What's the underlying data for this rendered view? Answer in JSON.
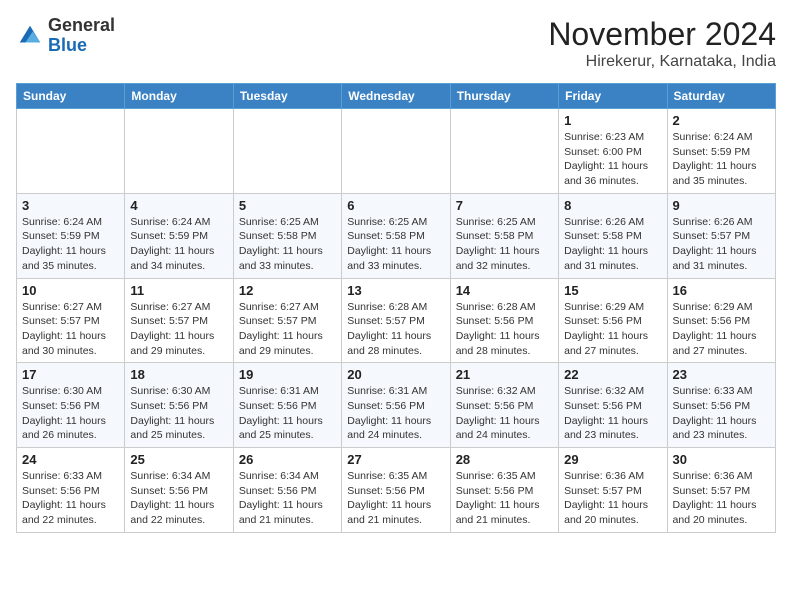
{
  "header": {
    "logo_general": "General",
    "logo_blue": "Blue",
    "month": "November 2024",
    "location": "Hirekerur, Karnataka, India"
  },
  "weekdays": [
    "Sunday",
    "Monday",
    "Tuesday",
    "Wednesday",
    "Thursday",
    "Friday",
    "Saturday"
  ],
  "weeks": [
    [
      {
        "day": "",
        "info": ""
      },
      {
        "day": "",
        "info": ""
      },
      {
        "day": "",
        "info": ""
      },
      {
        "day": "",
        "info": ""
      },
      {
        "day": "",
        "info": ""
      },
      {
        "day": "1",
        "info": "Sunrise: 6:23 AM\nSunset: 6:00 PM\nDaylight: 11 hours\nand 36 minutes."
      },
      {
        "day": "2",
        "info": "Sunrise: 6:24 AM\nSunset: 5:59 PM\nDaylight: 11 hours\nand 35 minutes."
      }
    ],
    [
      {
        "day": "3",
        "info": "Sunrise: 6:24 AM\nSunset: 5:59 PM\nDaylight: 11 hours\nand 35 minutes."
      },
      {
        "day": "4",
        "info": "Sunrise: 6:24 AM\nSunset: 5:59 PM\nDaylight: 11 hours\nand 34 minutes."
      },
      {
        "day": "5",
        "info": "Sunrise: 6:25 AM\nSunset: 5:58 PM\nDaylight: 11 hours\nand 33 minutes."
      },
      {
        "day": "6",
        "info": "Sunrise: 6:25 AM\nSunset: 5:58 PM\nDaylight: 11 hours\nand 33 minutes."
      },
      {
        "day": "7",
        "info": "Sunrise: 6:25 AM\nSunset: 5:58 PM\nDaylight: 11 hours\nand 32 minutes."
      },
      {
        "day": "8",
        "info": "Sunrise: 6:26 AM\nSunset: 5:58 PM\nDaylight: 11 hours\nand 31 minutes."
      },
      {
        "day": "9",
        "info": "Sunrise: 6:26 AM\nSunset: 5:57 PM\nDaylight: 11 hours\nand 31 minutes."
      }
    ],
    [
      {
        "day": "10",
        "info": "Sunrise: 6:27 AM\nSunset: 5:57 PM\nDaylight: 11 hours\nand 30 minutes."
      },
      {
        "day": "11",
        "info": "Sunrise: 6:27 AM\nSunset: 5:57 PM\nDaylight: 11 hours\nand 29 minutes."
      },
      {
        "day": "12",
        "info": "Sunrise: 6:27 AM\nSunset: 5:57 PM\nDaylight: 11 hours\nand 29 minutes."
      },
      {
        "day": "13",
        "info": "Sunrise: 6:28 AM\nSunset: 5:57 PM\nDaylight: 11 hours\nand 28 minutes."
      },
      {
        "day": "14",
        "info": "Sunrise: 6:28 AM\nSunset: 5:56 PM\nDaylight: 11 hours\nand 28 minutes."
      },
      {
        "day": "15",
        "info": "Sunrise: 6:29 AM\nSunset: 5:56 PM\nDaylight: 11 hours\nand 27 minutes."
      },
      {
        "day": "16",
        "info": "Sunrise: 6:29 AM\nSunset: 5:56 PM\nDaylight: 11 hours\nand 27 minutes."
      }
    ],
    [
      {
        "day": "17",
        "info": "Sunrise: 6:30 AM\nSunset: 5:56 PM\nDaylight: 11 hours\nand 26 minutes."
      },
      {
        "day": "18",
        "info": "Sunrise: 6:30 AM\nSunset: 5:56 PM\nDaylight: 11 hours\nand 25 minutes."
      },
      {
        "day": "19",
        "info": "Sunrise: 6:31 AM\nSunset: 5:56 PM\nDaylight: 11 hours\nand 25 minutes."
      },
      {
        "day": "20",
        "info": "Sunrise: 6:31 AM\nSunset: 5:56 PM\nDaylight: 11 hours\nand 24 minutes."
      },
      {
        "day": "21",
        "info": "Sunrise: 6:32 AM\nSunset: 5:56 PM\nDaylight: 11 hours\nand 24 minutes."
      },
      {
        "day": "22",
        "info": "Sunrise: 6:32 AM\nSunset: 5:56 PM\nDaylight: 11 hours\nand 23 minutes."
      },
      {
        "day": "23",
        "info": "Sunrise: 6:33 AM\nSunset: 5:56 PM\nDaylight: 11 hours\nand 23 minutes."
      }
    ],
    [
      {
        "day": "24",
        "info": "Sunrise: 6:33 AM\nSunset: 5:56 PM\nDaylight: 11 hours\nand 22 minutes."
      },
      {
        "day": "25",
        "info": "Sunrise: 6:34 AM\nSunset: 5:56 PM\nDaylight: 11 hours\nand 22 minutes."
      },
      {
        "day": "26",
        "info": "Sunrise: 6:34 AM\nSunset: 5:56 PM\nDaylight: 11 hours\nand 21 minutes."
      },
      {
        "day": "27",
        "info": "Sunrise: 6:35 AM\nSunset: 5:56 PM\nDaylight: 11 hours\nand 21 minutes."
      },
      {
        "day": "28",
        "info": "Sunrise: 6:35 AM\nSunset: 5:56 PM\nDaylight: 11 hours\nand 21 minutes."
      },
      {
        "day": "29",
        "info": "Sunrise: 6:36 AM\nSunset: 5:57 PM\nDaylight: 11 hours\nand 20 minutes."
      },
      {
        "day": "30",
        "info": "Sunrise: 6:36 AM\nSunset: 5:57 PM\nDaylight: 11 hours\nand 20 minutes."
      }
    ]
  ]
}
